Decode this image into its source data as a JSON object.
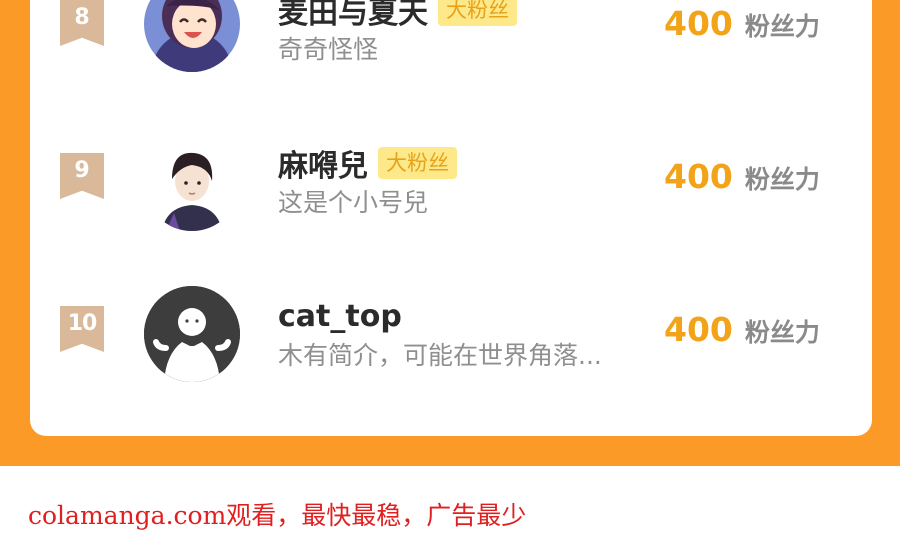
{
  "ranking": {
    "rows": [
      {
        "rank": "8",
        "name": "麦田与夏天",
        "badge": "大粉丝",
        "bio": "奇奇怪怪",
        "score": "400",
        "score_unit": "粉丝力",
        "avatar_icon": "anime-girl-avatar"
      },
      {
        "rank": "9",
        "name": "麻嘚兒",
        "badge": "大粉丝",
        "bio": "这是个小号兒",
        "score": "400",
        "score_unit": "粉丝力",
        "avatar_icon": "anime-boy-avatar"
      },
      {
        "rank": "10",
        "name": "cat_top",
        "badge": "",
        "bio": "木有简介，可能在世界角落...",
        "score": "400",
        "score_unit": "粉丝力",
        "avatar_icon": "default-user-avatar"
      }
    ]
  },
  "footer": {
    "text": "colamanga.com观看，最快最稳，广告最少"
  },
  "colors": {
    "background": "#fb9a26",
    "rank_badge": "#d9b99a",
    "score": "#f2a318",
    "fan_badge_bg": "#fde98a",
    "footer_text": "#e02020"
  }
}
